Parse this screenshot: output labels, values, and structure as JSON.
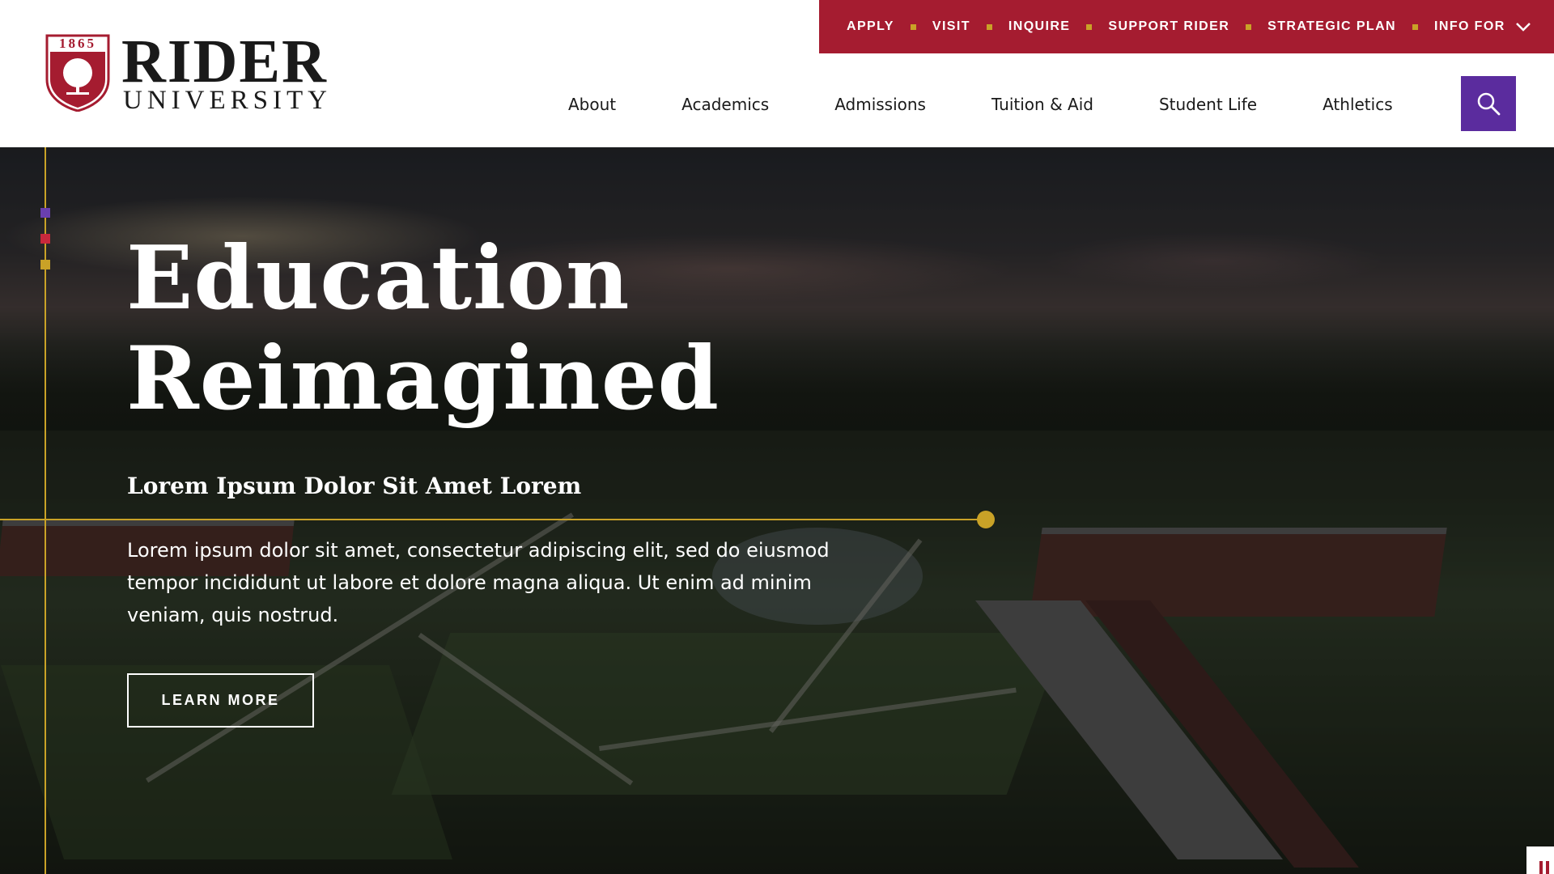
{
  "brand": {
    "year": "1865",
    "name": "RIDER",
    "subname": "UNIVERSITY",
    "crest_color": "#a51c30"
  },
  "utility_nav": {
    "background": "#a51c30",
    "separator_color": "#c9a227",
    "items": [
      "APPLY",
      "VISIT",
      "INQUIRE",
      "SUPPORT RIDER",
      "STRATEGIC PLAN"
    ],
    "info_for": "INFO FOR",
    "info_for_icon": "chevron-down-icon"
  },
  "main_nav": {
    "items": [
      "About",
      "Academics",
      "Admissions",
      "Tuition & Aid",
      "Student Life",
      "Athletics"
    ]
  },
  "search": {
    "icon": "search-icon",
    "color": "#5b2c9e"
  },
  "hero": {
    "title": "Education Reimagined",
    "subtitle": "Lorem Ipsum Dolor Sit Amet Lorem",
    "body": "Lorem ipsum dolor sit amet, consectetur adipiscing elit, sed do eiusmod tempor incididunt ut labore et dolore magna aliqua. Ut enim ad minim veniam, quis nostrud.",
    "button": "LEARN MORE",
    "accent_colors": [
      "#6a3fb0",
      "#c8283c",
      "#c9a227"
    ]
  }
}
